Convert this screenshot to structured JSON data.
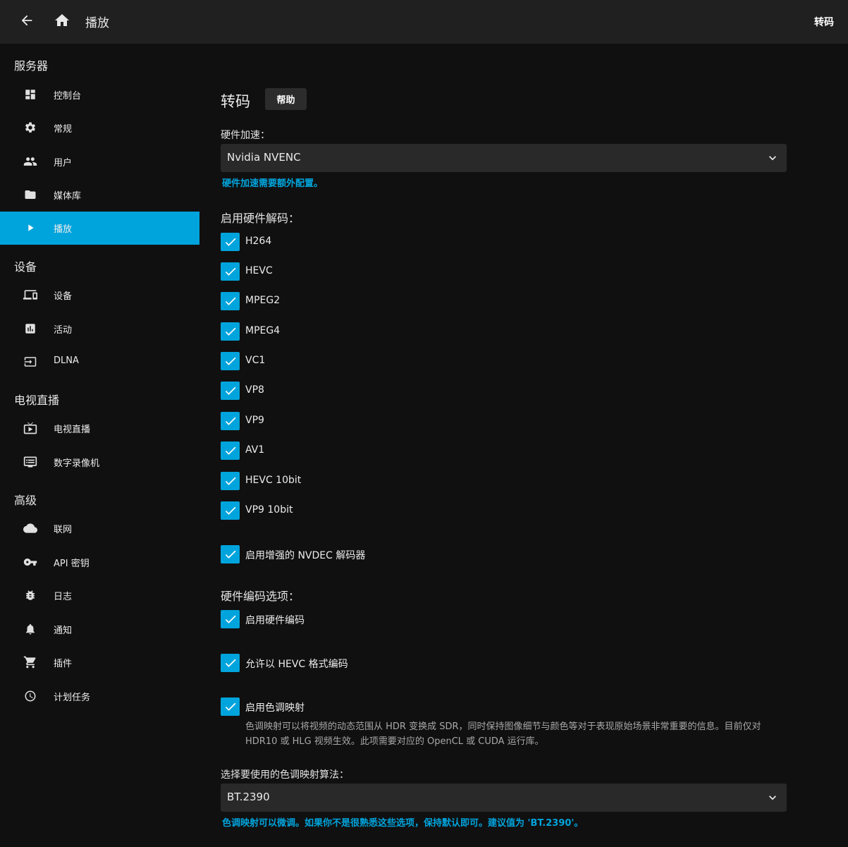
{
  "header": {
    "title": "播放",
    "right_label": "转码",
    "back_icon": "arrow-back-icon",
    "home_icon": "home-icon"
  },
  "sidebar": {
    "sections": [
      {
        "label": "服务器"
      },
      {
        "label": "设备"
      },
      {
        "label": "电视直播"
      },
      {
        "label": "高级"
      }
    ],
    "items": [
      {
        "label": "控制台",
        "icon": "dashboard-icon"
      },
      {
        "label": "常规",
        "icon": "gear-icon"
      },
      {
        "label": "用户",
        "icon": "users-icon"
      },
      {
        "label": "媒体库",
        "icon": "folder-icon"
      },
      {
        "label": "播放",
        "icon": "play-icon",
        "active": true
      },
      {
        "label": "设备",
        "icon": "devices-icon"
      },
      {
        "label": "活动",
        "icon": "activity-icon"
      },
      {
        "label": "DLNA",
        "icon": "input-icon"
      },
      {
        "label": "电视直播",
        "icon": "live-tv-icon"
      },
      {
        "label": "数字录像机",
        "icon": "dvr-icon"
      },
      {
        "label": "联网",
        "icon": "cloud-icon"
      },
      {
        "label": "API 密钥",
        "icon": "key-icon"
      },
      {
        "label": "日志",
        "icon": "bug-icon"
      },
      {
        "label": "通知",
        "icon": "bell-icon"
      },
      {
        "label": "插件",
        "icon": "cart-icon"
      },
      {
        "label": "计划任务",
        "icon": "clock-icon"
      }
    ]
  },
  "main": {
    "title": "转码",
    "help_label": "帮助",
    "hw_accel": {
      "label": "硬件加速：",
      "value": "Nvidia NVENC",
      "hint": "硬件加速需要额外配置。"
    },
    "decoding": {
      "label": "启用硬件解码：",
      "codecs": [
        {
          "label": "H264",
          "checked": true
        },
        {
          "label": "HEVC",
          "checked": true
        },
        {
          "label": "MPEG2",
          "checked": true
        },
        {
          "label": "MPEG4",
          "checked": true
        },
        {
          "label": "VC1",
          "checked": true
        },
        {
          "label": "VP8",
          "checked": true
        },
        {
          "label": "VP9",
          "checked": true
        },
        {
          "label": "AV1",
          "checked": true
        },
        {
          "label": "HEVC 10bit",
          "checked": true
        },
        {
          "label": "VP9 10bit",
          "checked": true
        }
      ]
    },
    "nvdec": {
      "label": "启用增强的 NVDEC 解码器",
      "checked": true
    },
    "encoding": {
      "label": "硬件编码选项：",
      "enable_hw_encoding": {
        "label": "启用硬件编码",
        "checked": true
      },
      "allow_hevc": {
        "label": "允许以 HEVC 格式编码",
        "checked": true
      },
      "tone_mapping": {
        "label": "启用色调映射",
        "checked": true,
        "description": "色调映射可以将视频的动态范围从 HDR 变换成 SDR，同时保持图像细节与颜色等对于表现原始场景非常重要的信息。目前仅对 HDR10 或 HLG 视频生效。此项需要对应的 OpenCL 或 CUDA 运行库。"
      }
    },
    "tonemap_algo": {
      "label": "选择要使用的色调映射算法：",
      "value": "BT.2390",
      "hint": "色调映射可以微调。如果你不是很熟悉这些选项，保持默认即可。建议值为 'BT.2390'。"
    }
  },
  "colors": {
    "accent": "#00a4dc",
    "header_bg": "#202020",
    "page_bg": "#101010",
    "input_bg": "#292929"
  }
}
